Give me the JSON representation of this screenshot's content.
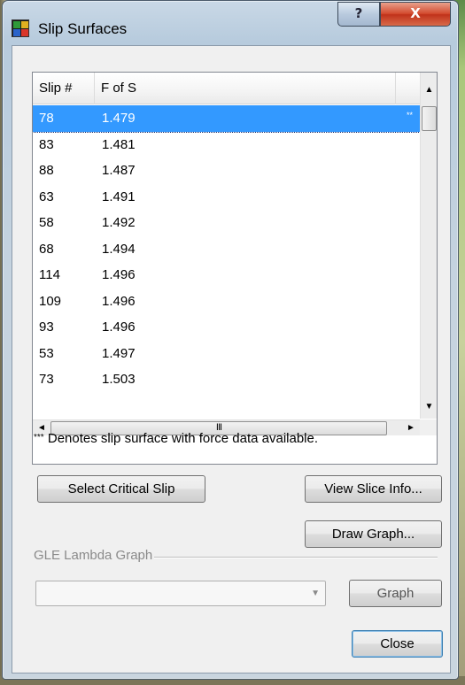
{
  "window": {
    "title": "Slip Surfaces",
    "help_label": "?",
    "close_label": "X"
  },
  "list": {
    "columns": [
      "Slip #",
      "F of S"
    ],
    "rows": [
      {
        "slip": "78",
        "fos": "1.479",
        "mark": "**",
        "selected": true
      },
      {
        "slip": "83",
        "fos": "1.481"
      },
      {
        "slip": "88",
        "fos": "1.487"
      },
      {
        "slip": "63",
        "fos": "1.491"
      },
      {
        "slip": "58",
        "fos": "1.492"
      },
      {
        "slip": "68",
        "fos": "1.494"
      },
      {
        "slip": "114",
        "fos": "1.496"
      },
      {
        "slip": "109",
        "fos": "1.496"
      },
      {
        "slip": "93",
        "fos": "1.496"
      },
      {
        "slip": "53",
        "fos": "1.497"
      },
      {
        "slip": "73",
        "fos": "1.503"
      }
    ],
    "hscroll_grip": "III"
  },
  "note": {
    "stars": "***",
    "text": " Denotes slip surface with force data available."
  },
  "buttons": {
    "select_critical": "Select Critical Slip",
    "view_slice": "View Slice Info...",
    "draw_graph": "Draw Graph...",
    "graph": "Graph",
    "close": "Close"
  },
  "gle": {
    "label": "GLE Lambda Graph",
    "combo_value": ""
  },
  "icons": {
    "scroll_up": "▲",
    "scroll_down": "▼",
    "scroll_left": "◄",
    "scroll_right": "►",
    "combo_arrow": "▼"
  },
  "colors": {
    "selection": "#3399ff",
    "close_button": "#c0321a"
  }
}
